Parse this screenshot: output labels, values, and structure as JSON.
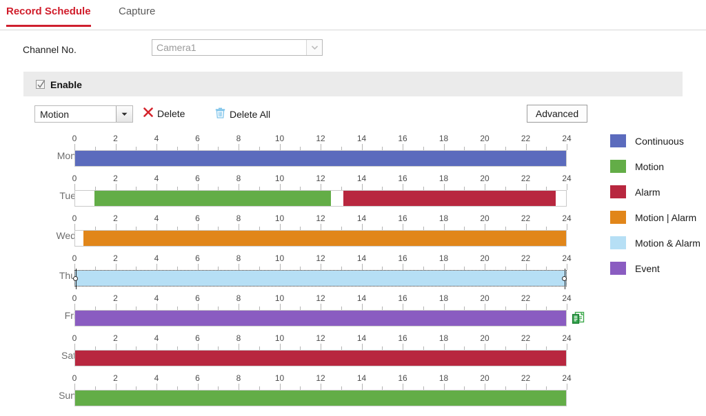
{
  "tabs": [
    {
      "id": "record-schedule",
      "label": "Record Schedule",
      "active": true
    },
    {
      "id": "capture",
      "label": "Capture",
      "active": false
    }
  ],
  "channel": {
    "label": "Channel No.",
    "selected": "Camera1",
    "options": [
      "Camera1"
    ],
    "dropdown_icon": "chevron-down-icon"
  },
  "enable": {
    "label": "Enable",
    "checked": true,
    "checkbox_icon": "checkmark-icon"
  },
  "toolbar": {
    "record_type": {
      "selected": "Motion",
      "options": [
        "Continuous",
        "Motion",
        "Alarm",
        "Motion | Alarm",
        "Motion & Alarm",
        "Event"
      ],
      "dropdown_icon": "chevron-down-icon"
    },
    "delete_label": "Delete",
    "delete_icon": "close-x-icon",
    "delete_all_label": "Delete All",
    "delete_all_icon": "trash-bin-icon",
    "advanced_label": "Advanced"
  },
  "schedule": {
    "axis": {
      "min": 0,
      "max": 24,
      "tick_step": 1,
      "label_step": 2,
      "labels": [
        "0",
        "2",
        "4",
        "6",
        "8",
        "10",
        "12",
        "14",
        "16",
        "18",
        "20",
        "22",
        "24"
      ]
    },
    "copy_icon": "copy-to-icon",
    "rows": [
      {
        "day": "Mon",
        "selected": false,
        "copy_icon_visible": false,
        "segments": [
          {
            "type": "Continuous",
            "color": "#5b6bbd",
            "start": 0,
            "end": 24
          }
        ]
      },
      {
        "day": "Tue",
        "selected": false,
        "copy_icon_visible": false,
        "segments": [
          {
            "type": "Motion",
            "color": "#63ad47",
            "start": 0.95,
            "end": 12.5
          },
          {
            "type": "Alarm",
            "color": "#b8273f",
            "start": 13.1,
            "end": 23.5
          }
        ]
      },
      {
        "day": "Wed",
        "selected": false,
        "copy_icon_visible": false,
        "segments": [
          {
            "type": "Motion | Alarm",
            "color": "#e1861a",
            "start": 0.4,
            "end": 24
          }
        ]
      },
      {
        "day": "Thu",
        "selected": true,
        "copy_icon_visible": false,
        "segments": [
          {
            "type": "Motion & Alarm",
            "color": "#b6dff5",
            "start": 0,
            "end": 24
          }
        ]
      },
      {
        "day": "Fri",
        "selected": false,
        "copy_icon_visible": true,
        "segments": [
          {
            "type": "Event",
            "color": "#8a5cc1",
            "start": 0,
            "end": 24
          }
        ]
      },
      {
        "day": "Sat",
        "selected": false,
        "copy_icon_visible": false,
        "segments": [
          {
            "type": "Alarm",
            "color": "#b8273f",
            "start": 0,
            "end": 24
          }
        ]
      },
      {
        "day": "Sun",
        "selected": false,
        "copy_icon_visible": false,
        "segments": [
          {
            "type": "Motion",
            "color": "#63ad47",
            "start": 0,
            "end": 24
          }
        ]
      }
    ]
  },
  "legend": [
    {
      "label": "Continuous",
      "color": "#5b6bbd"
    },
    {
      "label": "Motion",
      "color": "#63ad47"
    },
    {
      "label": "Alarm",
      "color": "#b8273f"
    },
    {
      "label": "Motion | Alarm",
      "color": "#e1861a"
    },
    {
      "label": "Motion & Alarm",
      "color": "#b6dff5"
    },
    {
      "label": "Event",
      "color": "#8a5cc1"
    }
  ],
  "colors": {
    "accent_red": "#cf1f2e",
    "panel_grey": "#ebebeb",
    "border_grey": "#d8d8d8"
  }
}
